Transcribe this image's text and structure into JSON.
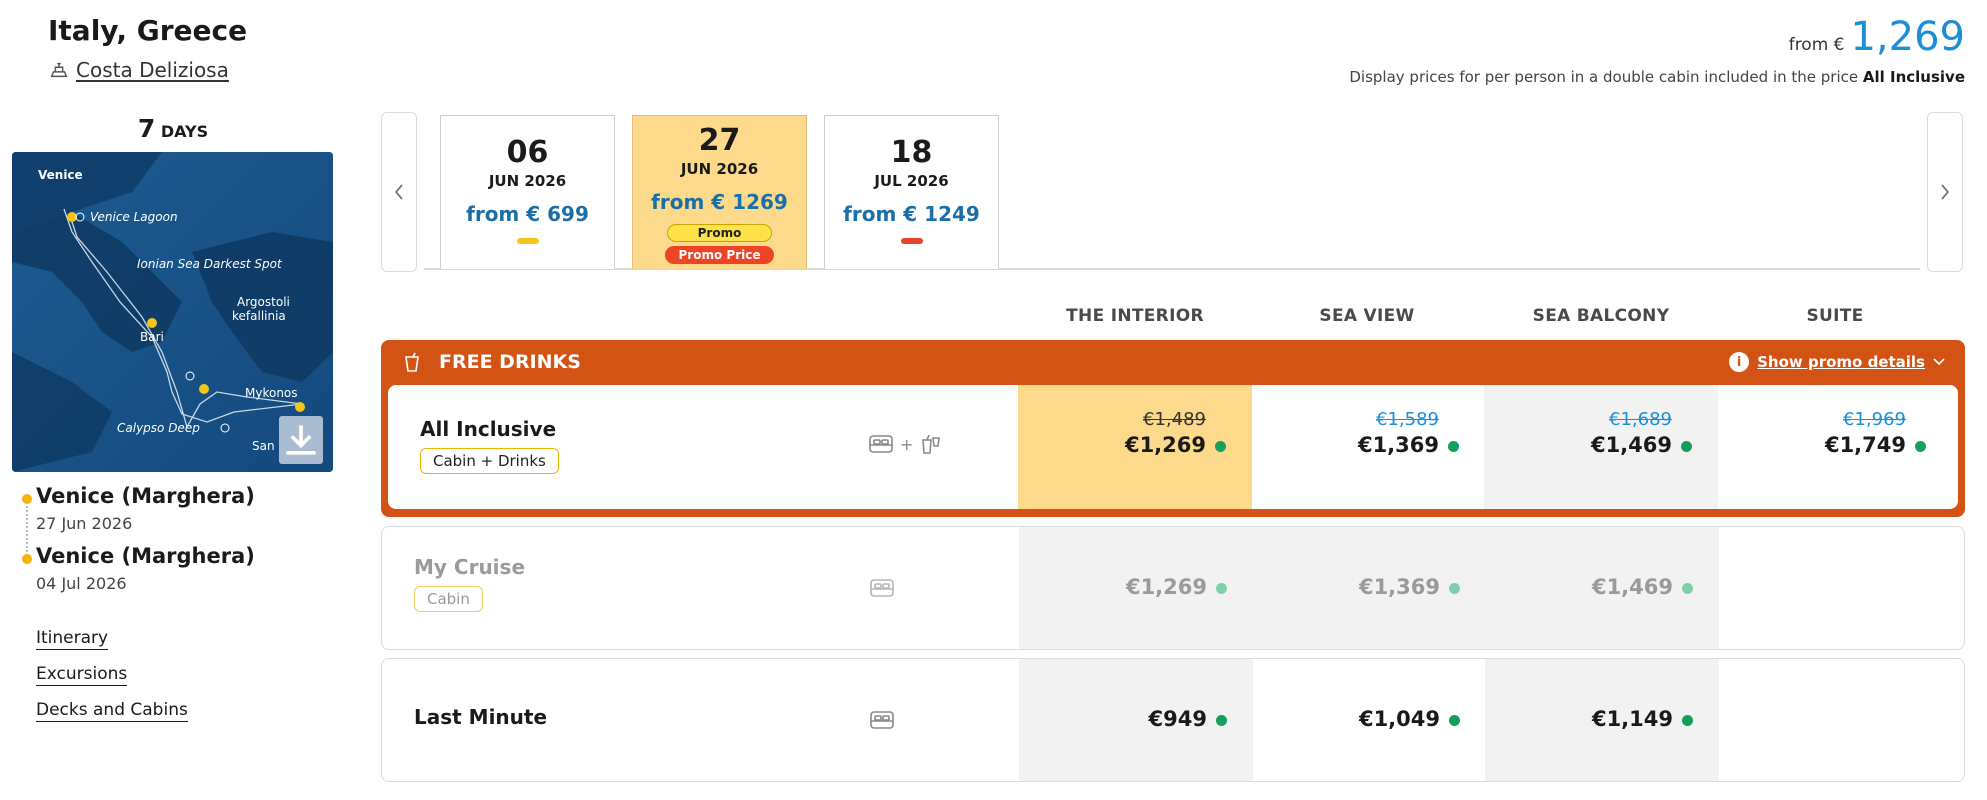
{
  "cruise": {
    "title": "Italy, Greece",
    "ship": "Costa Deliziosa",
    "days_number": "7",
    "days_label": "DAYS"
  },
  "map": {
    "labels": [
      "Venice",
      "Venice Lagoon",
      "Ionian Sea Darkest Spot",
      "Argostoli",
      "kefallinia",
      "Bari",
      "Mykonos",
      "Calypso Deep",
      "San"
    ]
  },
  "ports": [
    {
      "name": "Venice (Marghera)",
      "date": "27 Jun 2026"
    },
    {
      "name": "Venice (Marghera)",
      "date": "04 Jul 2026"
    }
  ],
  "links": [
    "Itinerary",
    "Excursions",
    "Decks and Cabins"
  ],
  "header": {
    "from_label": "from €",
    "from_price": "1,269",
    "disclaimer": "Display prices for per person in a double cabin included in the price",
    "disclaimer_bold": "All Inclusive"
  },
  "dates": [
    {
      "day": "06",
      "month": "JUN 2026",
      "price": "from € 699",
      "bar_color": "#f5c518",
      "selected": false
    },
    {
      "day": "27",
      "month": "JUN 2026",
      "price": "from € 1269",
      "promo": "Promo",
      "promo_price": "Promo Price",
      "selected": true
    },
    {
      "day": "18",
      "month": "JUL 2026",
      "price": "from € 1249",
      "bar_color": "#e8442a",
      "selected": false
    }
  ],
  "columns": [
    "THE INTERIOR",
    "SEA VIEW",
    "SEA BALCONY",
    "SUITE"
  ],
  "promo": {
    "title": "FREE DRINKS",
    "details": "Show promo details"
  },
  "rows": [
    {
      "name": "All Inclusive",
      "tag": "Cabin + Drinks",
      "icons_plus": "+",
      "old": [
        "€1,489",
        "€1,589",
        "€1,689",
        "€1,969"
      ],
      "prices": [
        "€1,269",
        "€1,369",
        "€1,469",
        "€1,749"
      ]
    },
    {
      "name": "My Cruise",
      "tag": "Cabin",
      "prices": [
        "€1,269",
        "€1,369",
        "€1,469"
      ]
    },
    {
      "name": "Last Minute",
      "prices": [
        "€949",
        "€1,049",
        "€1,149"
      ]
    }
  ],
  "colors": {
    "accent_orange": "#d35314",
    "highlight_yellow": "#fcd98b",
    "price_blue": "#1b8fd6",
    "available_green": "#12a05c",
    "strike_blue": "#1b8fd6"
  }
}
